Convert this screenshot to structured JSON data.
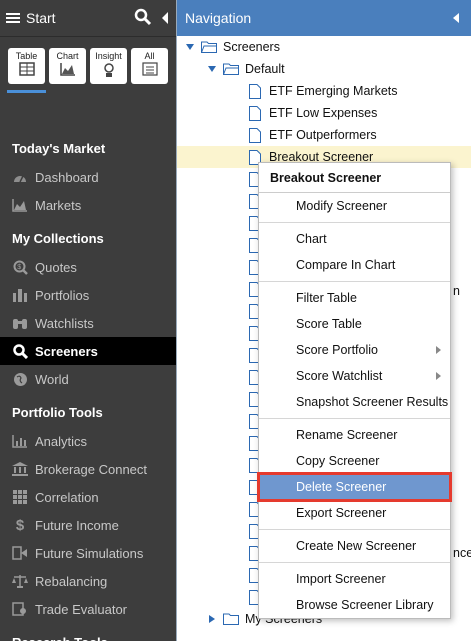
{
  "sidebar": {
    "title": "Start",
    "view_tabs": [
      {
        "label": "Table",
        "icon": "table-icon"
      },
      {
        "label": "Chart",
        "icon": "chart-icon"
      },
      {
        "label": "Insight",
        "icon": "insight-icon"
      },
      {
        "label": "All",
        "icon": "list-icon"
      }
    ],
    "sections": {
      "todays_market": "Today's Market",
      "my_collections": "My Collections",
      "portfolio_tools": "Portfolio Tools",
      "research_tools": "Research Tools"
    },
    "todays_market_items": [
      {
        "label": "Dashboard",
        "icon": "dashboard-icon"
      },
      {
        "label": "Markets",
        "icon": "markets-icon"
      }
    ],
    "collections_items": [
      {
        "label": "Quotes",
        "icon": "quotes-icon"
      },
      {
        "label": "Portfolios",
        "icon": "portfolios-icon"
      },
      {
        "label": "Watchlists",
        "icon": "binoculars-icon"
      },
      {
        "label": "Screeners",
        "icon": "search-icon",
        "active": true
      },
      {
        "label": "World",
        "icon": "globe-icon"
      }
    ],
    "portfolio_tools_items": [
      {
        "label": "Analytics",
        "icon": "analytics-icon"
      },
      {
        "label": "Brokerage Connect",
        "icon": "bank-icon"
      },
      {
        "label": "Correlation",
        "icon": "grid-icon"
      },
      {
        "label": "Future Income",
        "icon": "dollar-icon"
      },
      {
        "label": "Future Simulations",
        "icon": "simulations-icon"
      },
      {
        "label": "Rebalancing",
        "icon": "scale-icon"
      },
      {
        "label": "Trade Evaluator",
        "icon": "evaluator-icon"
      }
    ]
  },
  "nav": {
    "title": "Navigation",
    "root": "Screeners",
    "default_folder": "Default",
    "screeners": [
      "ETF Emerging Markets",
      "ETF Low Expenses",
      "ETF Outperformers",
      "Breakout Screener"
    ],
    "my_screeners": "My Screeners",
    "partial_right_1": "n",
    "partial_right_2": "nce"
  },
  "context_menu": {
    "title": "Breakout Screener",
    "groups": [
      [
        "Modify Screener"
      ],
      [
        "Chart",
        "Compare In Chart"
      ],
      [
        "Filter Table",
        "Score Table",
        "Score Portfolio",
        "Score Watchlist",
        "Snapshot Screener Results"
      ],
      [
        "Rename Screener",
        "Copy Screener",
        "Delete Screener",
        "Export Screener"
      ],
      [
        "Create New Screener"
      ],
      [
        "Import Screener",
        "Browse Screener Library"
      ]
    ],
    "selected": "Delete Screener",
    "submenu_items": [
      "Score Portfolio",
      "Score Watchlist"
    ]
  },
  "colors": {
    "sidebar_bg": "#3d3d3d",
    "nav_header": "#4a7fbd",
    "highlight_row": "#fbf4cf",
    "selected_item": "#6f97cf",
    "selection_outline": "#e53a2e"
  }
}
